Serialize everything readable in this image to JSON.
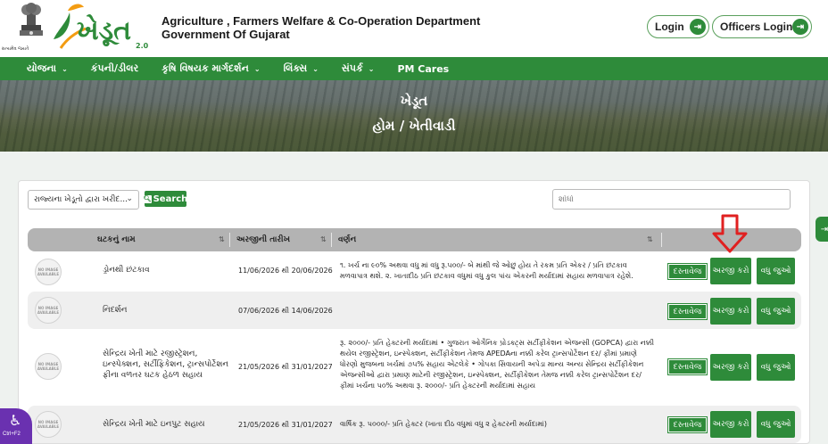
{
  "header": {
    "emblem_caption": "સત્યમેવ જયતે",
    "logo_text": "ખેડૂત",
    "logo_version": "2.0",
    "dept_line1": "Agriculture , Farmers Welfare & Co-Operation Department",
    "dept_line2": "Government Of Gujarat",
    "login_label": "Login",
    "officers_login_label": "Officers Login"
  },
  "nav": {
    "items": [
      {
        "label": "યોજના",
        "dropdown": true
      },
      {
        "label": "કંપની/ડીલર",
        "dropdown": false
      },
      {
        "label": "કૃષિ વિષયક માર્ગદર્શન",
        "dropdown": true
      },
      {
        "label": "લિંક્સ",
        "dropdown": true
      },
      {
        "label": "સંપર્ક",
        "dropdown": true
      },
      {
        "label": "PM Cares",
        "dropdown": false
      }
    ]
  },
  "banner": {
    "title": "ખેડૂત",
    "breadcrumb": "હોમ / ખેતીવાડી"
  },
  "filters": {
    "select_value": "રાજ્યના ખેડૂતો દ્વારા ખરીદ...",
    "search_button": "Search",
    "search_placeholder": "શોધો"
  },
  "table": {
    "columns": [
      "",
      "ઘટકનું નામ",
      "અરજીની તારીખ",
      "વર્ણન",
      ""
    ],
    "no_image_text": "NO IMAGE AVAILABLE",
    "doc_label": "દસ્તાવેજ",
    "apply_label": "અરજી કરો",
    "more_label": "વધુ જુઓ",
    "rows": [
      {
        "name": "ડ્રોનથી છંટકાવ",
        "date": "11/06/2026 થી 20/06/2026",
        "description": "૧. ખર્ચ ના ૯૦% અથવા વધુ માં વધુ રૂ.૫૦૦/- બે માંથી જે ઓછું હોય તે રકમ પ્રતિ એકર / પ્રતિ છંટકાવ મળવાપાત્ર થશે. ૨. ખાતાદીઠ પ્રતિ છંટકાવ વધુમાં વધુ કુલ પાંચ એકરની મર્યાદામાં સહાય મળવાપાત્ર રહેશે."
      },
      {
        "name": "નિદર્શન",
        "date": "07/06/2026 થી 14/06/2026",
        "description": ""
      },
      {
        "name": "સેન્દ્રિય ખેતી માટે રજીસ્ટ્રેશન, ઇન્સ્પેક્શન, સર્ટીફિકેશન, ટ્રાન્સપોર્ટેશન ફીના વળતર ઘટક હેઠળ સહાય",
        "date": "21/05/2026 થી 31/01/2027",
        "description": "રૂ. ૨૦૦૦/- પ્રતિ હેક્ટરની મર્યાદામાં • ગુજરાત ઓર્ગેનિક પ્રોડક્ટ્સ સર્ટીફીકેશન એજન્સી (GOPCA) દ્વારા નક્કી થયેલ રજીસ્ટ્રેશન, ઇન્સ્પેક્શન, સર્ટીફીકેશન તેમજ APEDAના નક્કી કરેલ ટ્રાન્સપોર્ટેશન દર/ ફીમાં પ્રમાણે ધોરણો મુજબના ખર્ચમાં ૭૫% સહાય એટલેકે • ગોપકા સિવાયની અપેડા માન્ય અન્ય સેન્દ્રિય સર્ટીફીકેશન એજન્સીઓ દ્વારા પ્રમાણ માટેની રજીસ્ટ્રેશન, ઇન્સ્પેક્શન, સર્ટીફીકેશન તેમજ નક્કી કરેલ ટ્રાન્સપોર્ટેશન દર/ ફીમાં ખર્ચના ૫૦% અથવા રૂ. ૨૦૦૦/- પ્રતિ હેક્ટરની મર્યાદામાં સહાય"
      },
      {
        "name": "સેન્દ્રિય ખેતી માટે ઇનપુટ સહાય",
        "date": "21/05/2026 થી 31/01/2027",
        "description": "વાર્ષિક રૂ. ૫૦૦૦/- પ્રતિ હેક્ટર (ખાતા દીઠ વધુમાં વધુ ૨ હેક્ટરની મર્યાદામાં)"
      }
    ]
  },
  "accessibility": {
    "shortcut": "Ctrl+F2"
  },
  "colors": {
    "primary_green": "#2e8b3a",
    "header_gray": "#b3b3b3",
    "arrow_red": "#e02020",
    "a11y_purple": "#6a31b0"
  }
}
